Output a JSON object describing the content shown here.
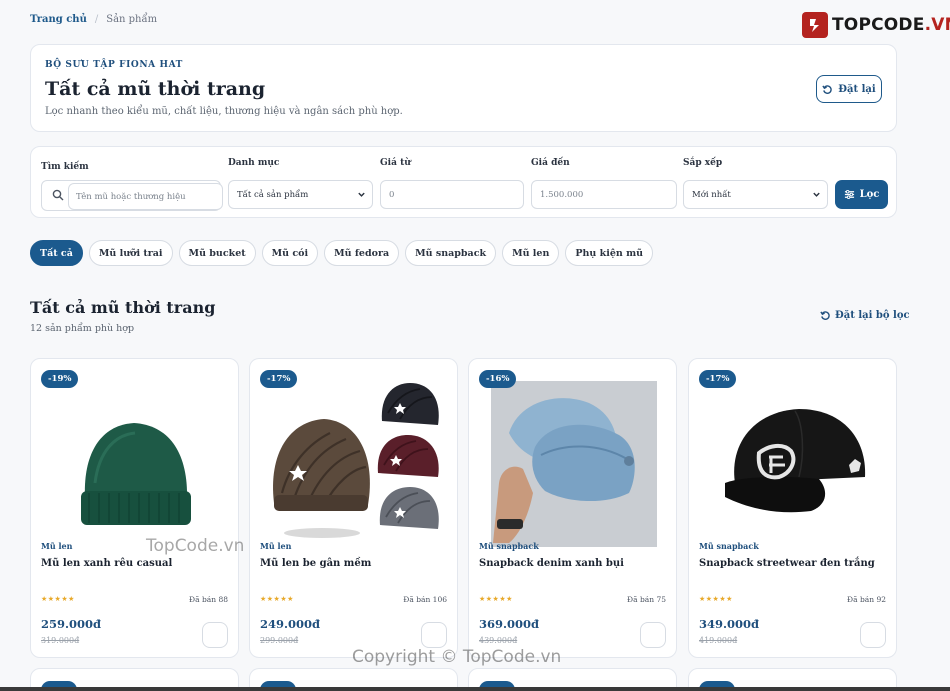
{
  "breadcrumb": {
    "home": "Trang chủ",
    "separator": "/",
    "current": "Sản phẩm"
  },
  "logo": {
    "text_main": "TOPCODE",
    "text_accent": ".VN"
  },
  "hero": {
    "kicker": "BỘ SƯU TẬP FIONA HAT",
    "title": "Tất cả mũ thời trang",
    "description": "Lọc nhanh theo kiểu mũ, chất liệu, thương hiệu và ngân sách phù hợp.",
    "reset_label": "Đặt lại"
  },
  "filters": {
    "search_label": "Tìm kiếm",
    "search_placeholder": "Tên mũ hoặc thương hiệu",
    "category_label": "Danh mục",
    "category_value": "Tất cả sản phẩm",
    "price_from_label": "Giá từ",
    "price_from_placeholder": "0",
    "price_to_label": "Giá đến",
    "price_to_placeholder": "1.500.000",
    "sort_label": "Sắp xếp",
    "sort_value": "Mới nhất",
    "submit_label": "Lọc"
  },
  "chips": [
    {
      "label": "Tất cả",
      "active": true
    },
    {
      "label": "Mũ lưỡi trai",
      "active": false
    },
    {
      "label": "Mũ bucket",
      "active": false
    },
    {
      "label": "Mũ cói",
      "active": false
    },
    {
      "label": "Mũ fedora",
      "active": false
    },
    {
      "label": "Mũ snapback",
      "active": false
    },
    {
      "label": "Mũ len",
      "active": false
    },
    {
      "label": "Phụ kiện mũ",
      "active": false
    }
  ],
  "section": {
    "title": "Tất cả mũ thời trang",
    "count": "12 sản phẩm phù hợp",
    "reset_label": "Đặt lại bộ lọc"
  },
  "products": [
    {
      "badge": "-19%",
      "category": "Mũ len",
      "name": "Mũ len xanh rêu casual",
      "stars": "★★★★★",
      "sold": "Đã bán 88",
      "price": "259.000đ",
      "old_price": "319.000đ",
      "rating": 5
    },
    {
      "badge": "-17%",
      "category": "Mũ len",
      "name": "Mũ len be gân mềm",
      "stars": "★★★★★",
      "sold": "Đã bán 106",
      "price": "249.000đ",
      "old_price": "299.000đ",
      "rating": 5
    },
    {
      "badge": "-16%",
      "category": "Mũ snapback",
      "name": "Snapback denim xanh bụi",
      "stars": "★★★★★",
      "sold": "Đã bán 75",
      "price": "369.000đ",
      "old_price": "439.000đ",
      "rating": 5
    },
    {
      "badge": "-17%",
      "category": "Mũ snapback",
      "name": "Snapback streetwear đen trắng",
      "stars": "★★★★★",
      "sold": "Đã bán 92",
      "price": "349.000đ",
      "old_price": "419.000đ",
      "rating": 5
    }
  ],
  "watermarks": {
    "top": "TopCode.vn",
    "bottom": "Copyright © TopCode.vn"
  },
  "colors": {
    "primary": "#1b5a8e",
    "accent_red": "#b4231f",
    "star": "#e8a92a"
  }
}
